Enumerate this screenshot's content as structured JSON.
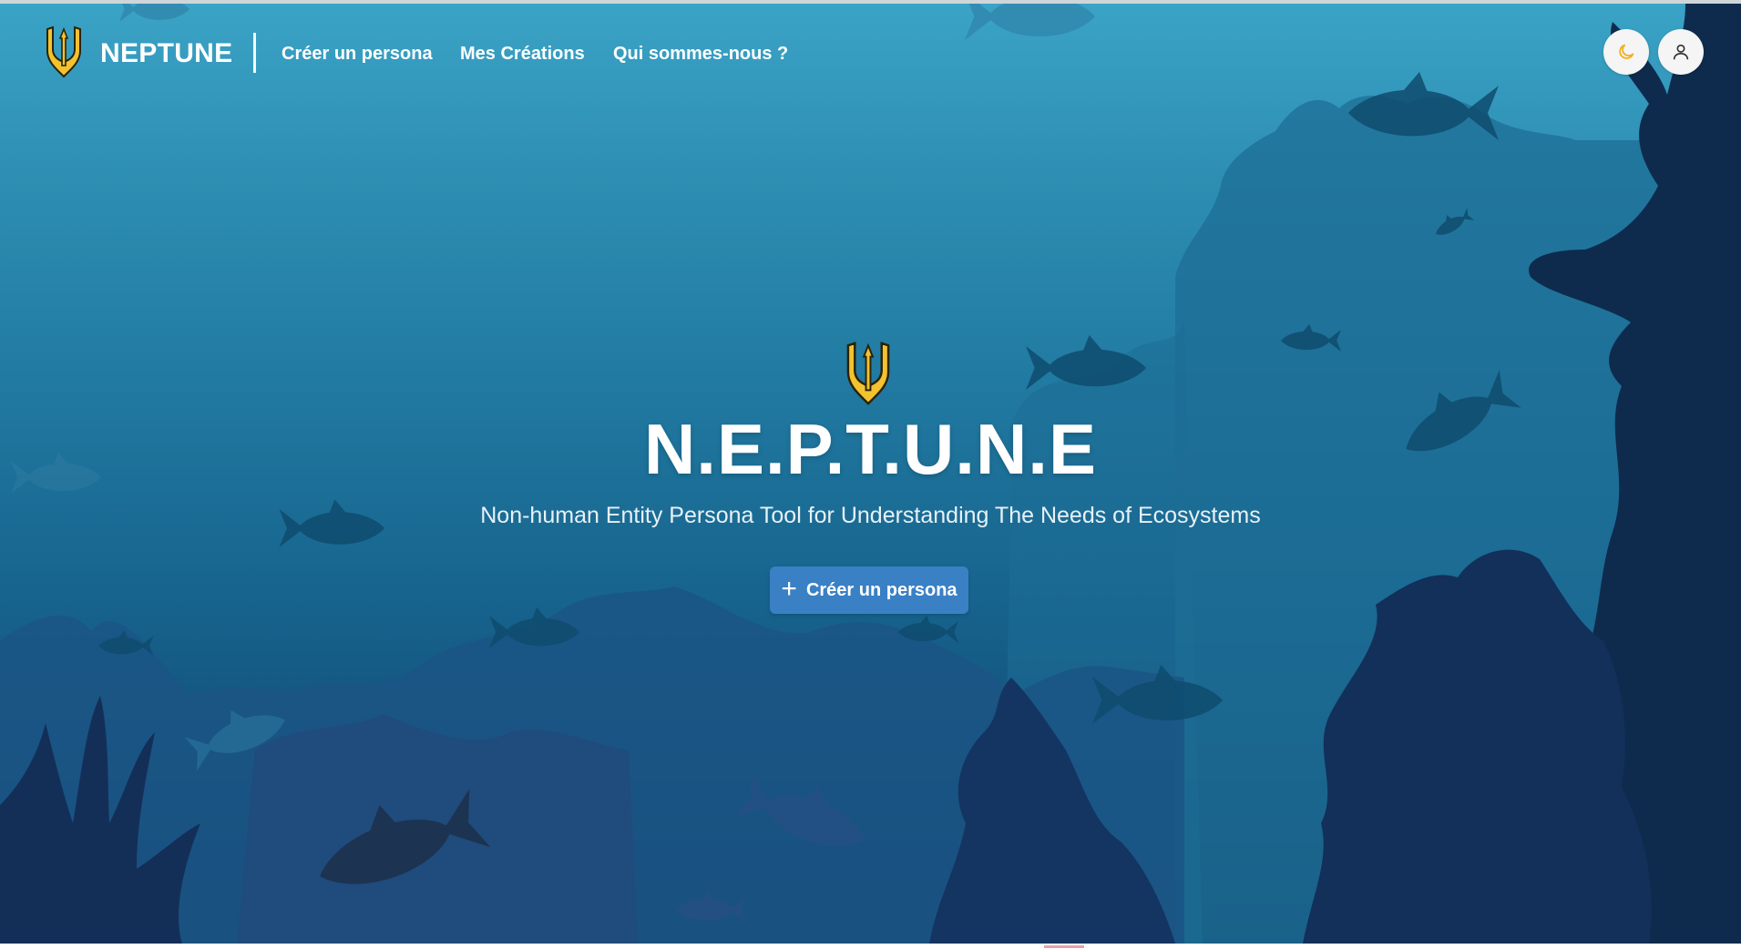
{
  "app": {
    "brand_name": "NEPTUNE",
    "logo_icon": "trident-shield-logo",
    "accent_gold": "#f2c230",
    "accent_blue": "#3a80c4"
  },
  "nav": {
    "links": [
      {
        "label": "Créer un persona"
      },
      {
        "label": "Mes Créations"
      },
      {
        "label": "Qui sommes-nous ?"
      }
    ],
    "theme_toggle_icon": "moon-icon",
    "account_icon": "user-icon"
  },
  "hero": {
    "title": "N.E.P.T.U.N.E",
    "subtitle": "Non-human Entity Persona Tool for Understanding The Needs of Ecosystems",
    "cta_label": "Créer un persona",
    "cta_icon": "plus-icon"
  }
}
